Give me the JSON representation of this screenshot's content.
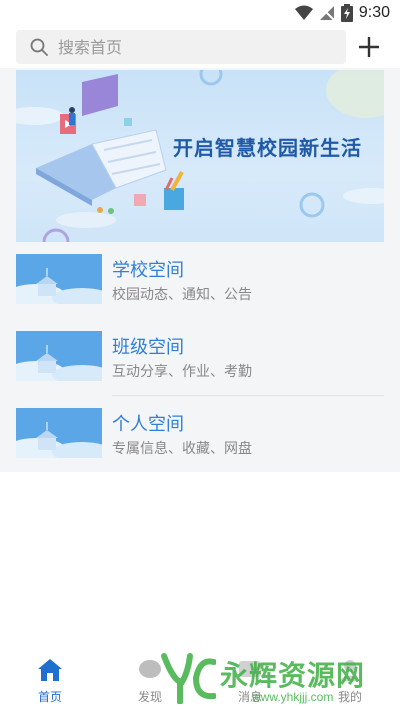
{
  "status": {
    "time": "9:30"
  },
  "search": {
    "placeholder": "搜索首页"
  },
  "banner": {
    "text": "开启智慧校园新生活"
  },
  "list": [
    {
      "title": "学校空间",
      "subtitle": "校园动态、通知、公告"
    },
    {
      "title": "班级空间",
      "subtitle": "互动分享、作业、考勤"
    },
    {
      "title": "个人空间",
      "subtitle": "专属信息、收藏、网盘"
    }
  ],
  "tabs": [
    {
      "label": "首页",
      "active": true
    },
    {
      "label": "发现"
    },
    {
      "label": "消息"
    },
    {
      "label": "我的"
    }
  ],
  "watermark": {
    "title": "永辉资源网",
    "url": "www.yhkjjj.com"
  },
  "colors": {
    "accent": "#2f7fd8",
    "tab_active": "#1f6fd1",
    "watermark": "#3db043"
  }
}
